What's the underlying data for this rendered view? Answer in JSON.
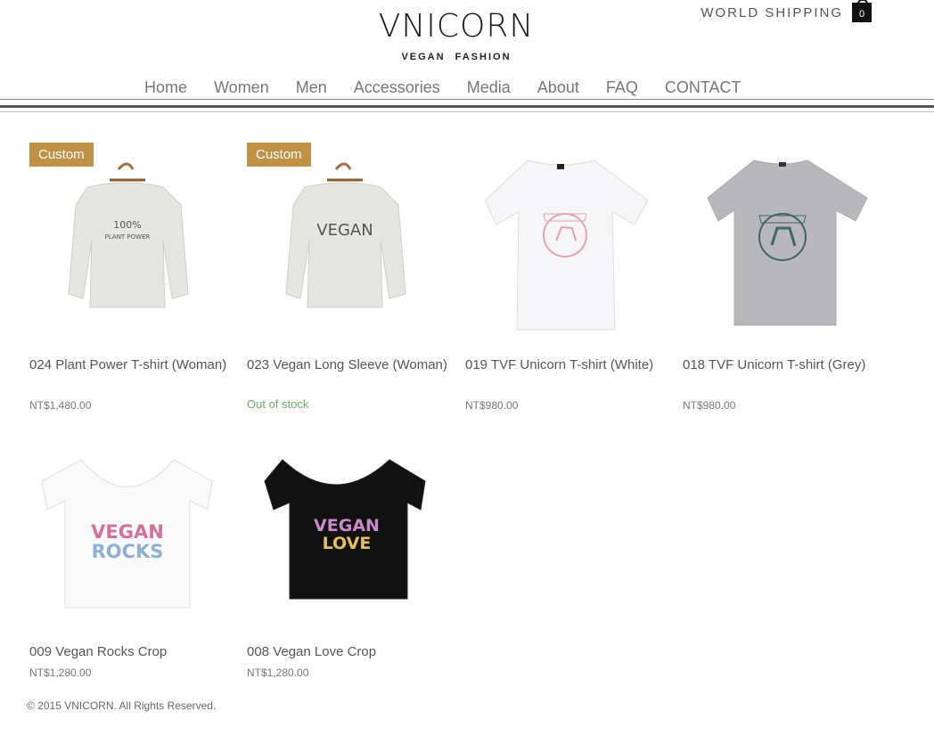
{
  "header": {
    "logo_title": "VNICORN",
    "logo_subtitle": "VEGAN FASHION",
    "shipping": "WORLD SHIPPING",
    "cart_count": "0"
  },
  "nav": [
    "Home",
    "Women",
    "Men",
    "Accessories",
    "Media",
    "About",
    "FAQ",
    "CONTACT"
  ],
  "products": [
    {
      "name": "024 Plant Power T-shirt (Woman)",
      "price": "NT$1,480.00",
      "badge": "Custom",
      "print": "100%\nPLANT POWER"
    },
    {
      "name": "023 Vegan Long Sleeve (Woman)",
      "price": "",
      "stock": "Out of stock",
      "badge": "Custom",
      "print": "VEGAN"
    },
    {
      "name": "019 TVF Unicorn T-shirt (White)",
      "price": "NT$980.00"
    },
    {
      "name": "018 TVF Unicorn T-shirt (Grey)",
      "price": "NT$980.00"
    },
    {
      "name": "009 Vegan Rocks Crop",
      "price": "NT$1,280.00",
      "print": "VEGAN\nROCKS"
    },
    {
      "name": "008 Vegan Love Crop",
      "price": "NT$1,280.00",
      "print": "VEGAN\nLOVE"
    }
  ],
  "colors": {
    "badge": "#c09045",
    "stock": "#6aa86a"
  },
  "footer": "© 2015 VNICORN. All Rights Reserved."
}
